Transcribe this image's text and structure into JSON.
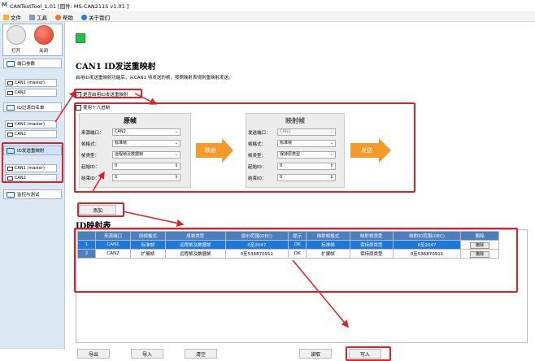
{
  "app": {
    "title": "CANTestTool_1.01 [固件: MS-CAN211S v1.01 ]"
  },
  "menu": {
    "items": [
      "文件",
      "工具",
      "帮助",
      "关于我们"
    ]
  },
  "sidebar": {
    "open": "打开",
    "close": "关闭",
    "port_params": "端口参数",
    "can1": "CAN1 (master)",
    "can2": "CAN2",
    "id_whitelist": "ID过滤白名单",
    "id_remap": "ID发送重映射",
    "monitor": "监控与测试"
  },
  "page": {
    "title": "CAN1 ID发送重映射",
    "desc": "启用ID发送重映射功能后，从CAN1 待发送的帧，按照映射表规则重映射发送。",
    "enable_label": "是否启用ID发送重映射",
    "hex_label": "使用十六进制"
  },
  "source": {
    "title": "原帧",
    "port_label": "来源端口：",
    "port": "CAN2",
    "format_label": "帧格式：",
    "format": "标准帧",
    "type_label": "帧类型：",
    "type": "远程帧及数据帧",
    "start_label": "起始ID：",
    "start": "0",
    "end_label": "结束ID：",
    "end": "0"
  },
  "mapped": {
    "title": "映射帧",
    "port_label": "发送端口：",
    "port": "CAN1",
    "format_label": "帧格式：",
    "format": "标准帧",
    "type_label": "帧类型：",
    "type": "保持原类型",
    "start_label": "起始ID：",
    "start": "0",
    "end_label": "结束ID：",
    "end": "0"
  },
  "arrows": {
    "map": "映射",
    "send": "发送"
  },
  "add": "添加",
  "table": {
    "title": "ID映射表",
    "headers": [
      "来源端口",
      "原帧格式",
      "原帧类型",
      "原ID范围(DEC)",
      "提示",
      "映射帧格式",
      "映射帧类型",
      "映射ID范围(DEC)",
      "删除"
    ],
    "rows": [
      {
        "idx": "1",
        "port": "CAN1",
        "fmt": "标准帧",
        "type": "远程帧及数据帧",
        "range": "0至2047",
        "tip": "OK",
        "mfmt": "标准帧",
        "mtype": "保持原类型",
        "mrange": "0至2047",
        "del": "删除"
      },
      {
        "idx": "2",
        "port": "CAN2",
        "fmt": "扩展帧",
        "type": "远程帧及数据帧",
        "range": "0至536870911",
        "tip": "OK",
        "mfmt": "扩展帧",
        "mtype": "保持原类型",
        "mrange": "0至536870911",
        "del": "删除"
      }
    ]
  },
  "footer": {
    "export": "导出",
    "import": "导入",
    "clear": "清空",
    "read": "读取",
    "write": "写入"
  }
}
